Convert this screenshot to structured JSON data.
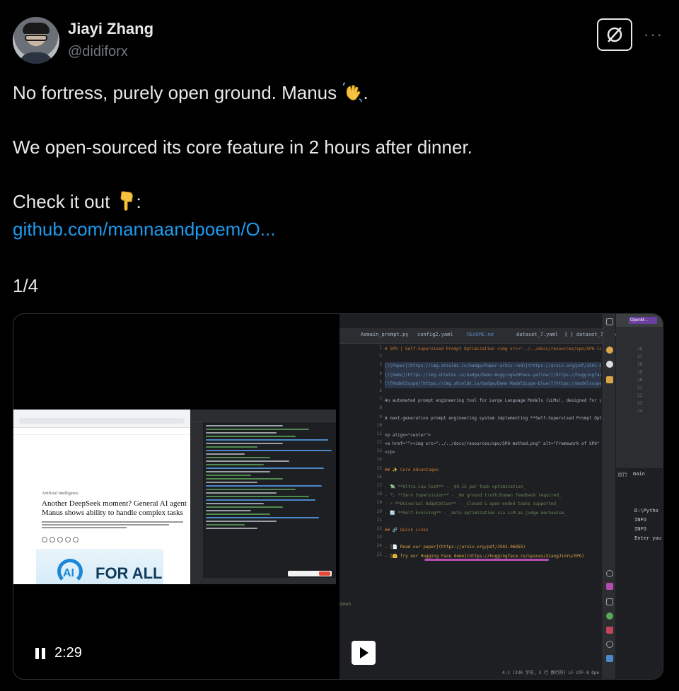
{
  "author": {
    "name": "Jiayi Zhang",
    "handle": "@didiforx"
  },
  "tweet": {
    "line1": "No fortress, purely open ground. Manus",
    "line1_end": ".",
    "line2": "We open-sourced its core feature in 2 hours after dinner.",
    "line3": "Check it out",
    "line3_end": ":",
    "link": "github.com/mannaandpoem/O...",
    "counter": "1/4"
  },
  "media": {
    "video_time": "2:29",
    "browser": {
      "kicker": "Artificial Intelligence",
      "headline": "Another DeepSeek moment? General AI agent Manus shows ability to handle complex tasks",
      "hero_logo": "AI",
      "hero_text": "FOR ALL"
    },
    "ide": {
      "tabs": [
        "Aomain_prompt.py",
        "config2.yaml",
        "README.md",
        "dataset_7.yaml",
        "{ } dataset_7i--sc"
      ],
      "line_numbers": [
        "1",
        "2",
        "3",
        "4",
        "5",
        "6",
        "7",
        "8",
        "9",
        "10",
        "11",
        "12",
        "13",
        "14",
        "15",
        "16",
        "17",
        "18",
        "19",
        "20",
        "21",
        "22",
        "23",
        "24",
        "25"
      ],
      "code": [
        "# SPO | Self-Supervised Prompt Optimization <img src=\"../../docs/resources/spo/SPO-logo.",
        "",
        "[![Paper](https://img.shields.io/badge/Paper-arXiv-red)](https://arxiv.org/pdf/2502.0685",
        "[![Demo](https://img.shields.io/badge/Demo-Hugging%20Face-yellow)](https://huggingface.c",
        "[![ModelScope](https://img.shields.io/badge/Demo-ModelScope-blue)](https://modelscope.c",
        "",
        "An automated prompt engineering tool for Large Language Models (LLMs), designed for univ",
        "",
        "A next-generation prompt engineering system implementing **Self-Supervised Prompt Optimi",
        "",
        "<p align=\"center\">",
        "<a href=\"\"><img src=\"../../docs/resources/spo/SPO-method.png\" alt=\"Framework of SPO\" tit",
        "</p>",
        "",
        "## ✨ Core Advantages",
        "",
        "- 💸 **Ultra-Low Cost** - _$0.15 per task optimization_",
        "- 🏷 **Zero Supervision** - _No ground truth/human feedback required_",
        "- ⚡ **Universal Adaptation** - _Closed & open-ended tasks supported_",
        "- 🔄 **Self-Evolving** - _Auto-optimization via LLM-as-judge mechanism_",
        "",
        "## 🔗 Quick Links",
        "",
        "- [📄 Read our paper](https://arxiv.org/pdf/2502.06855)",
        "- [🤗 Try our Hugging Face demo](https://huggingface.co/spaces/XiangJinYu/SPO)"
      ],
      "right_panel": {
        "pill": "OpenM...",
        "line_numbers": [
          "16",
          "17",
          "18",
          "19",
          "20",
          "21",
          "22",
          "23",
          "24"
        ],
        "run_tab": "main",
        "run_label": "运行",
        "output": [
          "D:\\Pytho",
          "INFO",
          "INFO",
          "Enter you"
        ]
      },
      "bottom_link": "dows",
      "status": "4:1 (230 字符, 3 行 换行符)   LF   UTF-8   Ope"
    }
  }
}
